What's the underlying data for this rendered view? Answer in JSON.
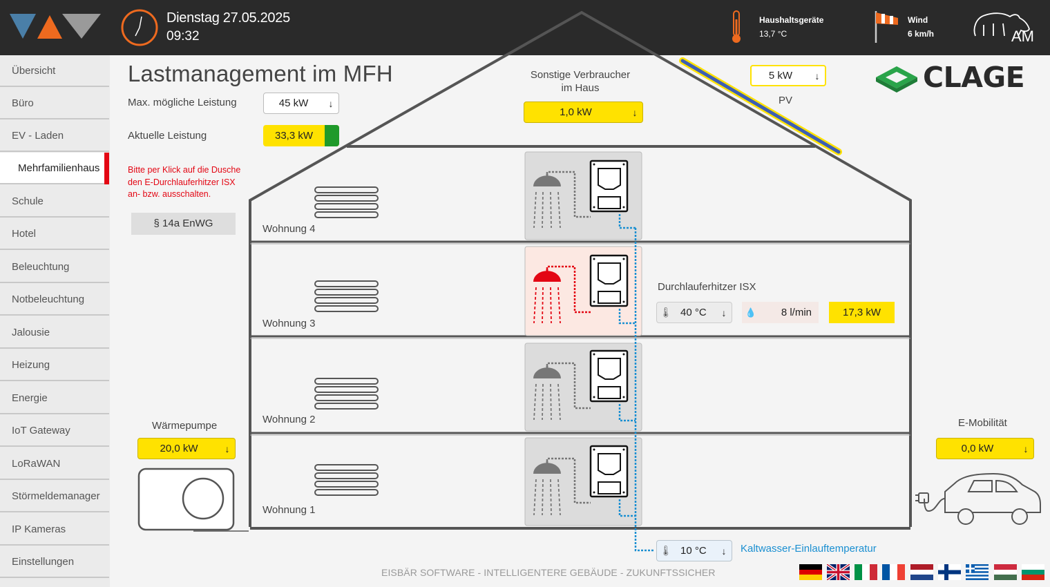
{
  "header": {
    "date": "Dienstag 27.05.2025",
    "time": "09:32",
    "appliance_label": "Haushaltsgeräte",
    "appliance_temp": "13,7 °C",
    "wind_label": "Wind",
    "wind_value": "6 km/h",
    "brand_text": "AM"
  },
  "sidebar": {
    "items": [
      {
        "label": "Übersicht"
      },
      {
        "label": "Büro"
      },
      {
        "label": "EV - Laden"
      },
      {
        "label": "Mehrfamilienhaus",
        "active": true
      },
      {
        "label": "Schule"
      },
      {
        "label": "Hotel"
      },
      {
        "label": "Beleuchtung"
      },
      {
        "label": "Notbeleuchtung"
      },
      {
        "label": "Jalousie"
      },
      {
        "label": "Heizung"
      },
      {
        "label": "Energie"
      },
      {
        "label": "IoT Gateway"
      },
      {
        "label": "LoRaWAN"
      },
      {
        "label": "Störmeldemanager"
      },
      {
        "label": "IP Kameras"
      },
      {
        "label": "Einstellungen"
      }
    ]
  },
  "main": {
    "title": "Lastmanagement im MFH",
    "max_power_label": "Max. mögliche Leistung",
    "max_power_value": "45 kW",
    "current_power_label": "Aktuelle Leistung",
    "current_power_value": "33,3 kW",
    "hint": [
      "Bitte per Klick auf die Dusche",
      "den E-Durchlauferhitzer ISX",
      "an- bzw. ausschalten."
    ],
    "btn_14a": "§ 14a EnWG",
    "other_consumers_label": [
      "Sonstige Verbraucher",
      "im Haus"
    ],
    "other_consumers_value": "1,0 kW",
    "pv_value": "5 kW",
    "pv_label": "PV",
    "brand": "CLAGE",
    "apartments": [
      "Wohnung 4",
      "Wohnung 3",
      "Wohnung 2",
      "Wohnung 1"
    ],
    "heater_label": "Durchlauferhitzer ISX",
    "heater_temp": "40 °C",
    "heater_flow": "8 l/min",
    "heater_power": "17,3 kW",
    "heatpump_label": "Wärmepumpe",
    "heatpump_value": "20,0 kW",
    "emobility_label": "E-Mobilität",
    "emobility_value": "0,0 kW",
    "cold_water_temp": "10 °C",
    "cold_water_label": "Kaltwasser-Einlauftemperatur",
    "footer": "EISBÄR SOFTWARE - INTELLIGENTERE GEBÄUDE - ZUKUNFTSSICHER"
  },
  "colors": {
    "accent_red": "#e30613",
    "yellow": "#ffe200",
    "active_shower": "#e30613",
    "cold_water": "#1a8fd1",
    "clage_green": "#2aa44a"
  },
  "flags": [
    "de",
    "gb",
    "it",
    "fr",
    "nl",
    "fi",
    "gr",
    "hu",
    "bg"
  ]
}
